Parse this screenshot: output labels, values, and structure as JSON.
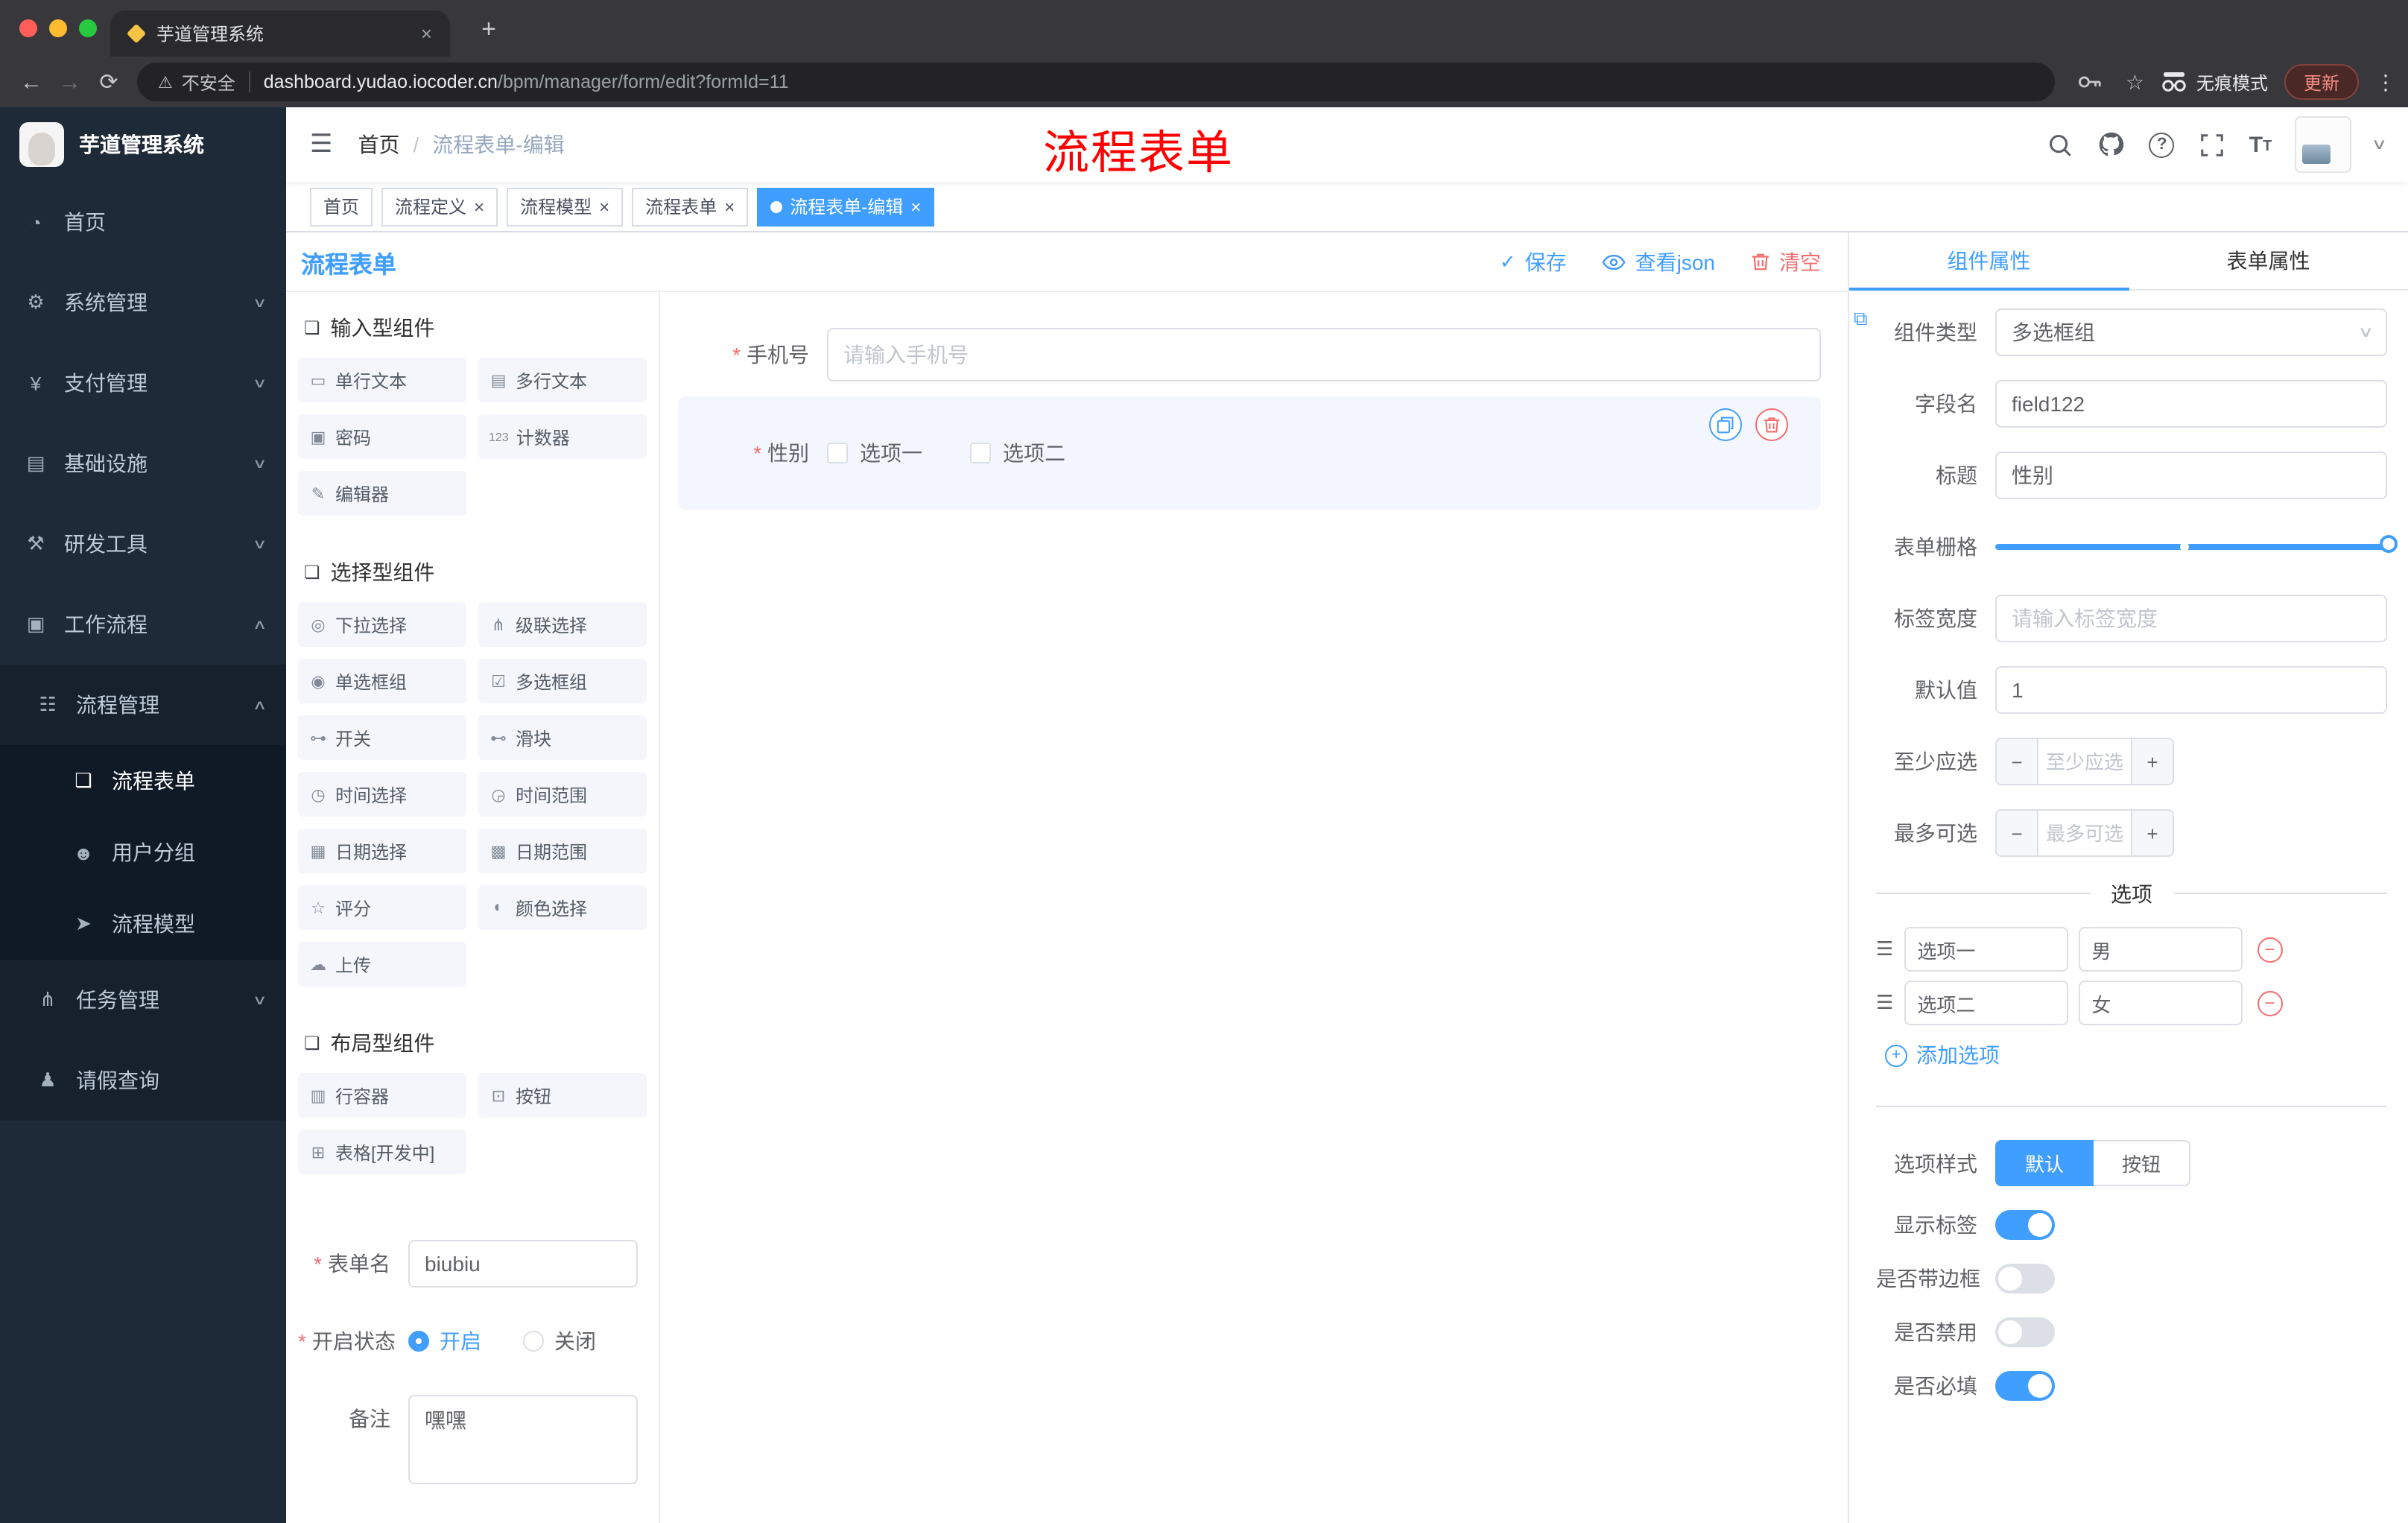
{
  "colors": {
    "accent": "#409EFF",
    "danger": "#F56C6C",
    "annotation": "#FF0000",
    "sidebar_bg": "#1E2A38",
    "active_tag_bg": "#409EFF"
  },
  "glyphs": {
    "hamburger": "☰",
    "back": "←",
    "forward": "→",
    "reload": "⟳",
    "warning": "⚠",
    "star": "☆",
    "kebab": "⋮",
    "newtab": "+",
    "close": "×",
    "caret_down": "∨",
    "caret_up": "∧",
    "slash": "/",
    "check": "✓",
    "minus": "−",
    "plus": "+",
    "font_size": "T",
    "question": "?",
    "drag": "☰",
    "section": "❏",
    "link": "⧉"
  },
  "browser": {
    "tab_title": "芋道管理系统",
    "security_label": "不安全",
    "url_domain": "dashboard.yudao.iocoder.cn",
    "url_path": "/bpm/manager/form/edit?formId=11",
    "incognito_label": "无痕模式",
    "update_label": "更新"
  },
  "sidebar": {
    "logo_text": "芋道管理系统",
    "items": [
      {
        "glyph": "◔",
        "label": "首页"
      },
      {
        "glyph": "⚙",
        "label": "系统管理",
        "chevron": "∨"
      },
      {
        "glyph": "¥",
        "label": "支付管理",
        "chevron": "∨"
      },
      {
        "glyph": "▤",
        "label": "基础设施",
        "chevron": "∨"
      },
      {
        "glyph": "⚒",
        "label": "研发工具",
        "chevron": "∨"
      },
      {
        "glyph": "▣",
        "label": "工作流程",
        "chevron": "∧"
      },
      {
        "glyph": "☷",
        "label": "流程管理",
        "chevron": "∧"
      },
      {
        "glyph": "❏",
        "label": "流程表单"
      },
      {
        "glyph": "☻",
        "label": "用户分组"
      },
      {
        "glyph": "➤",
        "label": "流程模型"
      },
      {
        "glyph": "⋔",
        "label": "任务管理",
        "chevron": "∨"
      },
      {
        "glyph": "♟",
        "label": "请假查询"
      }
    ]
  },
  "header": {
    "breadcrumb_home": "首页",
    "breadcrumb_current": "流程表单-编辑",
    "annotation": "流程表单"
  },
  "tags": [
    {
      "label": "首页"
    },
    {
      "label": "流程定义"
    },
    {
      "label": "流程模型"
    },
    {
      "label": "流程表单"
    },
    {
      "label": "流程表单-编辑"
    }
  ],
  "designer": {
    "title": "流程表单",
    "save_label": "保存",
    "view_json_label": "查看json",
    "clear_label": "清空"
  },
  "library": {
    "groups": [
      {
        "title": "输入型组件",
        "items": [
          {
            "glyph": "▭",
            "label": "单行文本"
          },
          {
            "glyph": "▤",
            "label": "多行文本"
          },
          {
            "glyph": "▣",
            "label": "密码"
          },
          {
            "glyph": "123",
            "label": "计数器"
          },
          {
            "glyph": "✎",
            "label": "编辑器"
          }
        ]
      },
      {
        "title": "选择型组件",
        "items": [
          {
            "glyph": "◎",
            "label": "下拉选择"
          },
          {
            "glyph": "⋔",
            "label": "级联选择"
          },
          {
            "glyph": "◉",
            "label": "单选框组"
          },
          {
            "glyph": "☑",
            "label": "多选框组"
          },
          {
            "glyph": "⊶",
            "label": "开关"
          },
          {
            "glyph": "⊷",
            "label": "滑块"
          },
          {
            "glyph": "◷",
            "label": "时间选择"
          },
          {
            "glyph": "◶",
            "label": "时间范围"
          },
          {
            "glyph": "▦",
            "label": "日期选择"
          },
          {
            "glyph": "▩",
            "label": "日期范围"
          },
          {
            "glyph": "☆",
            "label": "评分"
          },
          {
            "glyph": "◐",
            "label": "颜色选择"
          },
          {
            "glyph": "☁",
            "label": "上传"
          }
        ]
      },
      {
        "title": "布局型组件",
        "items": [
          {
            "glyph": "▥",
            "label": "行容器"
          },
          {
            "glyph": "⊡",
            "label": "按钮"
          },
          {
            "glyph": "⊞",
            "label": "表格[开发中]"
          }
        ]
      }
    ]
  },
  "meta_form": {
    "required_mark": "*",
    "name_label": "表单名",
    "name_value": "biubiu",
    "status_label": "开启状态",
    "status_on": "开启",
    "status_off": "关闭",
    "remark_label": "备注",
    "remark_value": "嘿嘿"
  },
  "canvas": {
    "required_mark": "*",
    "phone_label": "手机号",
    "phone_placeholder": "请输入手机号",
    "gender_label": "性别",
    "gender_option1": "选项一",
    "gender_option2": "选项二"
  },
  "props": {
    "tab_component": "组件属性",
    "tab_form": "表单属性",
    "type_label": "组件类型",
    "type_value": "多选框组",
    "field_label": "字段名",
    "field_value": "field122",
    "title_label": "标题",
    "title_value": "性别",
    "grid_label": "表单栅格",
    "label_width_label": "标签宽度",
    "label_width_placeholder": "请输入标签宽度",
    "default_label": "默认值",
    "default_value": "1",
    "min_label": "至少应选",
    "min_placeholder": "至少应选",
    "max_label": "最多可选",
    "max_placeholder": "最多可选",
    "options_title": "选项",
    "options": [
      {
        "name": "选项一",
        "value": "男"
      },
      {
        "name": "选项二",
        "value": "女"
      }
    ],
    "add_option_label": "添加选项",
    "style_label": "选项样式",
    "style_default": "默认",
    "style_button": "按钮",
    "switches": [
      {
        "label": "显示标签",
        "state": "on"
      },
      {
        "label": "是否带边框",
        "state": "off"
      },
      {
        "label": "是否禁用",
        "state": "off"
      },
      {
        "label": "是否必填",
        "state": "on"
      }
    ]
  }
}
